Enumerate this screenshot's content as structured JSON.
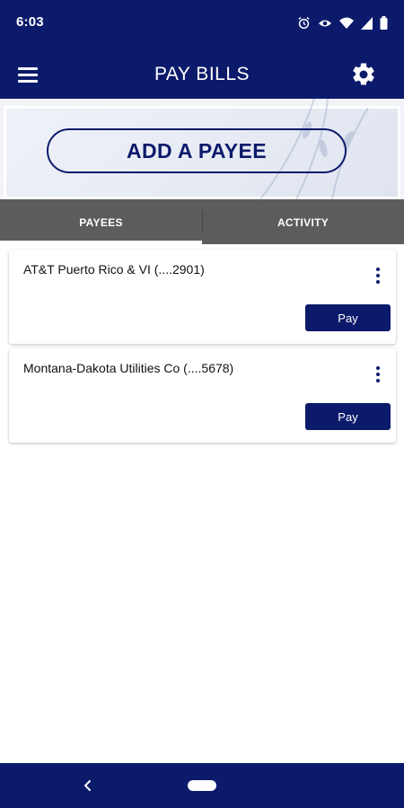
{
  "status_bar": {
    "time": "6:03",
    "icons": [
      "alarm-icon",
      "eye-icon",
      "wifi-icon",
      "signal-icon",
      "battery-icon"
    ]
  },
  "app_bar": {
    "title": "PAY BILLS",
    "menu_icon": "hamburger-menu-icon",
    "settings_icon": "gear-icon"
  },
  "hero": {
    "add_payee_label": "ADD A PAYEE"
  },
  "tabs": [
    {
      "label": "PAYEES",
      "active": true
    },
    {
      "label": "ACTIVITY",
      "active": false
    }
  ],
  "payees": [
    {
      "name": "AT&T Puerto Rico & VI (....2901)",
      "pay_label": "Pay"
    },
    {
      "name": "Montana-Dakota Utilities Co (....5678)",
      "pay_label": "Pay"
    }
  ],
  "nav_bar": {
    "back_icon": "back-chevron-icon",
    "home_icon": "home-pill-icon"
  },
  "colors": {
    "brand_navy": "#0c1a6b",
    "tab_bar": "#5c5c5c",
    "hero_bg": "#f1f3f8"
  }
}
